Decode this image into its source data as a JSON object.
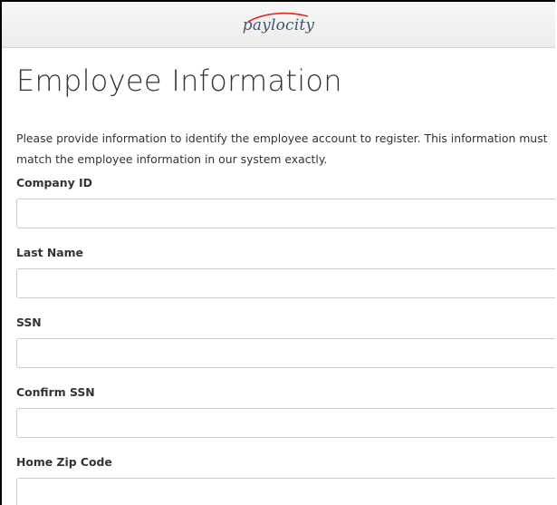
{
  "header": {
    "logo_text": "paylocity",
    "swoosh_color": "#e2231a"
  },
  "page": {
    "title": "Employee Information",
    "intro": "Please provide information to identify the employee account to register. This information must match the employee information in our system exactly."
  },
  "form": {
    "fields": [
      {
        "label": "Company ID",
        "value": "",
        "placeholder": ""
      },
      {
        "label": "Last Name",
        "value": "",
        "placeholder": ""
      },
      {
        "label": "SSN",
        "value": "",
        "placeholder": ""
      },
      {
        "label": "Confirm SSN",
        "value": "",
        "placeholder": ""
      },
      {
        "label": "Home Zip Code",
        "value": "",
        "placeholder": ""
      }
    ]
  }
}
